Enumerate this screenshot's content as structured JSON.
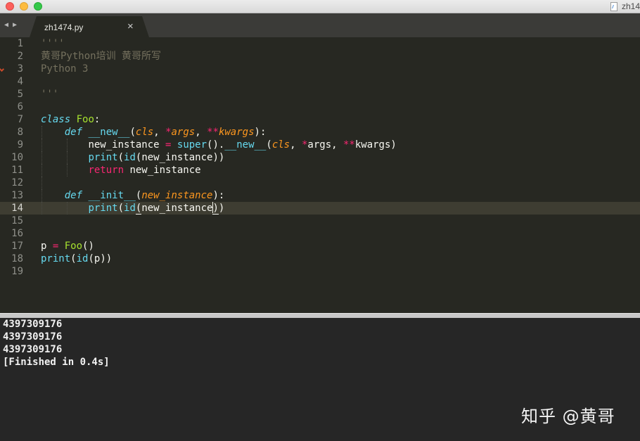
{
  "window": {
    "title": "zh14"
  },
  "tab": {
    "label": "zh1474.py",
    "close": "×",
    "back": "◀",
    "forward": "▶"
  },
  "editor": {
    "active_line": 14,
    "lines": [
      {
        "n": "1",
        "t": "''''"
      },
      {
        "n": "2",
        "t": "黄哥Python培训 黄哥所写"
      },
      {
        "n": "3",
        "t": "Python 3"
      },
      {
        "n": "4",
        "t": ""
      },
      {
        "n": "5",
        "t": "'''"
      },
      {
        "n": "6",
        "t": ""
      },
      {
        "n": "7",
        "t": "class Foo:"
      },
      {
        "n": "8",
        "t": "    def __new__(cls, *args, **kwargs):"
      },
      {
        "n": "9",
        "t": "        new_instance = super().__new__(cls, *args, **kwargs)"
      },
      {
        "n": "10",
        "t": "        print(id(new_instance))"
      },
      {
        "n": "11",
        "t": "        return new_instance"
      },
      {
        "n": "12",
        "t": ""
      },
      {
        "n": "13",
        "t": "    def __init__(new_instance):"
      },
      {
        "n": "14",
        "t": "        print(id(new_instance))"
      },
      {
        "n": "15",
        "t": ""
      },
      {
        "n": "16",
        "t": ""
      },
      {
        "n": "17",
        "t": "p = Foo()"
      },
      {
        "n": "18",
        "t": "print(id(p))"
      },
      {
        "n": "19",
        "t": ""
      }
    ],
    "tokens": {
      "docstring_open": "''''",
      "comment_line": "黄哥Python培训 黄哥所写",
      "python_version": "Python 3",
      "docstring_close": "'''",
      "kw_class": "class",
      "cls_name": "Foo",
      "colon": ":",
      "kw_def": "def",
      "fn_new": "__new__",
      "lparen": "(",
      "rparen": ")",
      "p_cls": "cls",
      "comma": ", ",
      "star": "*",
      "dstar": "**",
      "p_args": "args",
      "p_kwargs": "kwargs",
      "var_new_instance": "new_instance",
      "assign": " = ",
      "bi_super": "super",
      "dot": ".",
      "bi_print": "print",
      "bi_id": "id",
      "kw_return": "return",
      "fn_init": "__init__",
      "var_p": "p",
      "var_p_paren": "p"
    }
  },
  "output": {
    "lines": [
      "4397309176",
      "4397309176",
      "4397309176",
      "[Finished in 0.4s]"
    ]
  },
  "watermark": "知乎 @黄哥"
}
